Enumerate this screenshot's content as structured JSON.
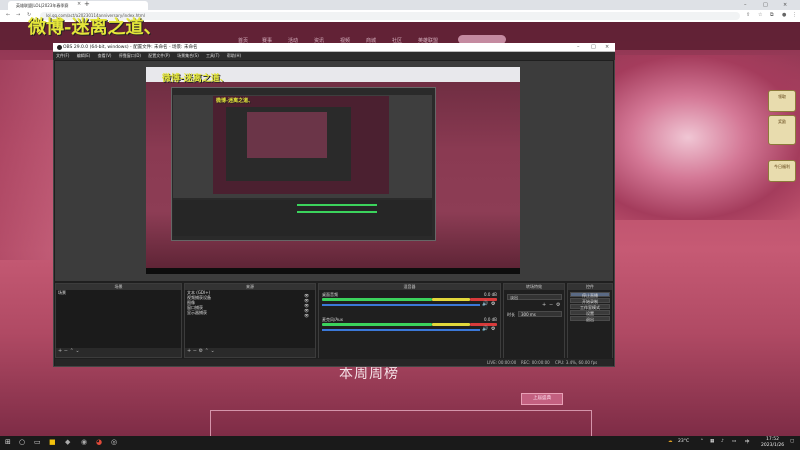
{
  "browser": {
    "tab_title": "英雄联盟|LOL|2023年春季赛",
    "tab_close": "×",
    "new_tab": "+",
    "address": "lol.qq.com/act/a20230114anniversary/index.html",
    "win_controls": [
      "–",
      "□",
      "×"
    ]
  },
  "watermark": {
    "text": "微博-迷离之道、"
  },
  "obs": {
    "title": "OBS 29.0.0 (64-bit, windows) - 配置文件: 未命名 - 场景: 未命名",
    "menu": [
      "文件(F)",
      "编辑(E)",
      "查看(V)",
      "停靠窗口(D)",
      "配置文件(P)",
      "场景集合(S)",
      "工具(T)",
      "帮助(H)"
    ],
    "docks": {
      "scenes": {
        "title": "场景",
        "items": [
          "场景"
        ]
      },
      "sources": {
        "title": "来源",
        "items": [
          "文本 (GDI+)",
          "视频捕获设备",
          "图像",
          "窗口捕获",
          "显示器捕获"
        ]
      },
      "mixer": {
        "title": "混音器",
        "tracks": [
          {
            "name": "桌面音频",
            "db": "0.0 dB"
          },
          {
            "name": "麦克风/Aux",
            "db": "0.0 dB"
          }
        ]
      },
      "transitions": {
        "title": "转场特效",
        "type": "淡出",
        "duration_label": "时长",
        "duration": "300 ms"
      },
      "controls": {
        "title": "控件",
        "buttons": [
          "停止直播",
          "开始录制",
          "工作室模式",
          "设置",
          "退出"
        ]
      }
    },
    "status": {
      "live": "LIVE: 00:00:00",
      "rec": "REC: 00:00:00",
      "cpu": "CPU: 3.4%, 60.00 fps"
    }
  },
  "webpage": {
    "nav_links": [
      "首页",
      "赛事",
      "活动",
      "资讯",
      "视频",
      "商城",
      "社区",
      "英雄联盟"
    ],
    "weekly_title": "本周周榜",
    "button": "上届盛典",
    "side_badges": [
      "领取",
      "奖励",
      "今日福利"
    ]
  },
  "taskbar": {
    "temp": "23°C",
    "time": "17:52",
    "date": "2023/1/26",
    "lang": "中"
  },
  "colors": {
    "page_bg": "#b44a66",
    "watermark": "#e4e63a",
    "obs_bg": "#1f1f1f",
    "meter_green": "#3bd35c",
    "meter_yellow": "#e3d83b",
    "meter_red": "#d83b3b",
    "meter_blue": "#3b78d8"
  },
  "icons": [
    "windows-start-icon",
    "search-icon",
    "task-view-icon",
    "chrome-icon",
    "obs-icon",
    "explorer-icon",
    "speaker-icon",
    "network-icon"
  ]
}
